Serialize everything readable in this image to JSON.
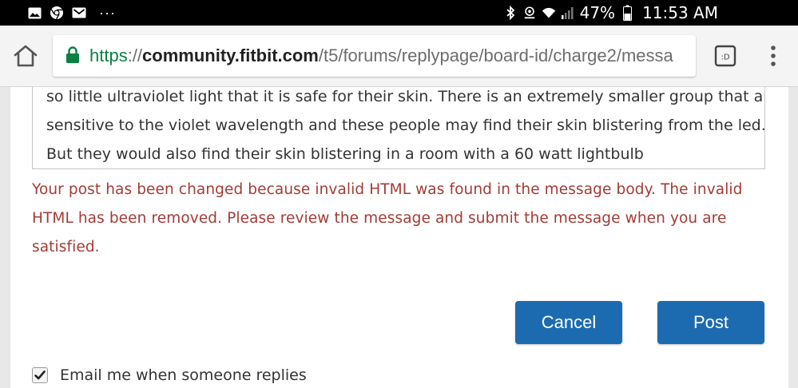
{
  "status_bar": {
    "left_icons": [
      "image-icon",
      "chrome-icon",
      "gmail-icon"
    ],
    "overflow": "···",
    "battery_percent": "47%",
    "time": "11:53 AM"
  },
  "browser": {
    "url_scheme": "https",
    "url_separator": "://",
    "url_host": "community.fitbit.com",
    "url_path": "/t5/forums/replypage/board-id/charge2/messa",
    "tab_switcher_label": ":D",
    "accent_secure": "#0b8043"
  },
  "editor": {
    "lines": [
      "so little ultraviolet light that it is safe for their skin. There is an extremely smaller group that are",
      "sensitive to the violet wavelength and these people may find their skin blistering from the led.",
      "But they would also find their skin blistering in a room with a 60 watt lightbulb"
    ]
  },
  "notice": {
    "error_message": "Your post has been changed because invalid HTML was found in the message body. The invalid HTML has been removed. Please review the message and submit the message when you are satisfied.",
    "color": "#a33b35"
  },
  "actions": {
    "cancel_label": "Cancel",
    "post_label": "Post",
    "button_color": "#1c6bb0"
  },
  "options": {
    "email_checked": true,
    "email_label": "Email me when someone replies"
  }
}
